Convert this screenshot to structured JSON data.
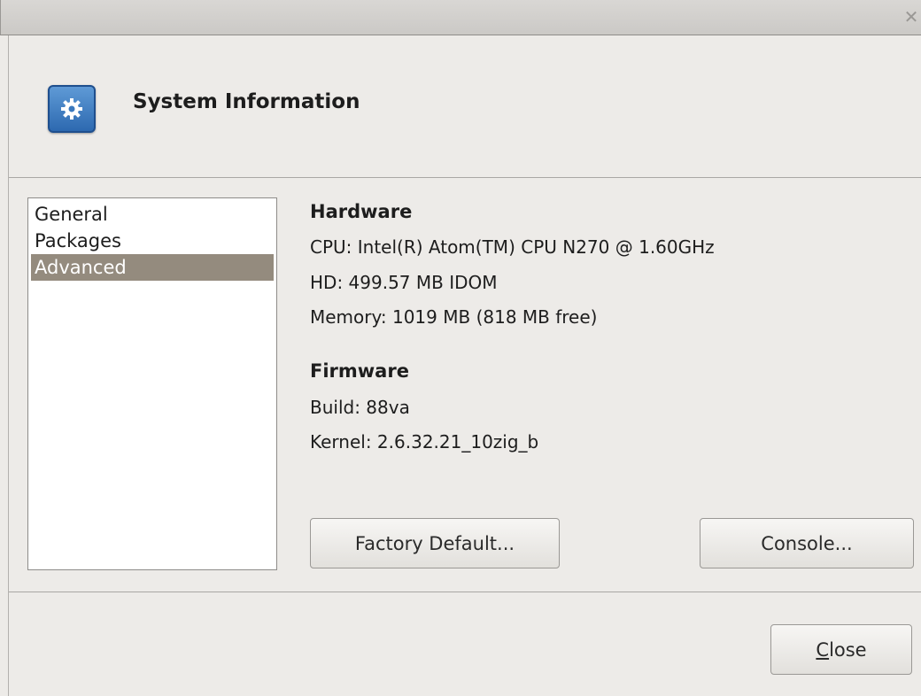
{
  "dialog": {
    "title": "System Information",
    "window_close_icon": "close-x-icon",
    "header_icon": "gear-icon"
  },
  "sidebar": {
    "items": [
      {
        "label": "General",
        "selected": false
      },
      {
        "label": "Packages",
        "selected": false
      },
      {
        "label": "Advanced",
        "selected": true
      }
    ]
  },
  "hardware": {
    "heading": "Hardware",
    "cpu": "CPU: Intel(R) Atom(TM) CPU N270 @ 1.60GHz",
    "hd": "HD: 499.57 MB IDOM",
    "memory": "Memory: 1019 MB (818 MB free)"
  },
  "firmware": {
    "heading": "Firmware",
    "build": "Build: 88va",
    "kernel": "Kernel: 2.6.32.21_10zig_b"
  },
  "buttons": {
    "factory_default": "Factory Default...",
    "console": "Console...",
    "close_mnemonic": "C",
    "close_rest": "lose"
  }
}
